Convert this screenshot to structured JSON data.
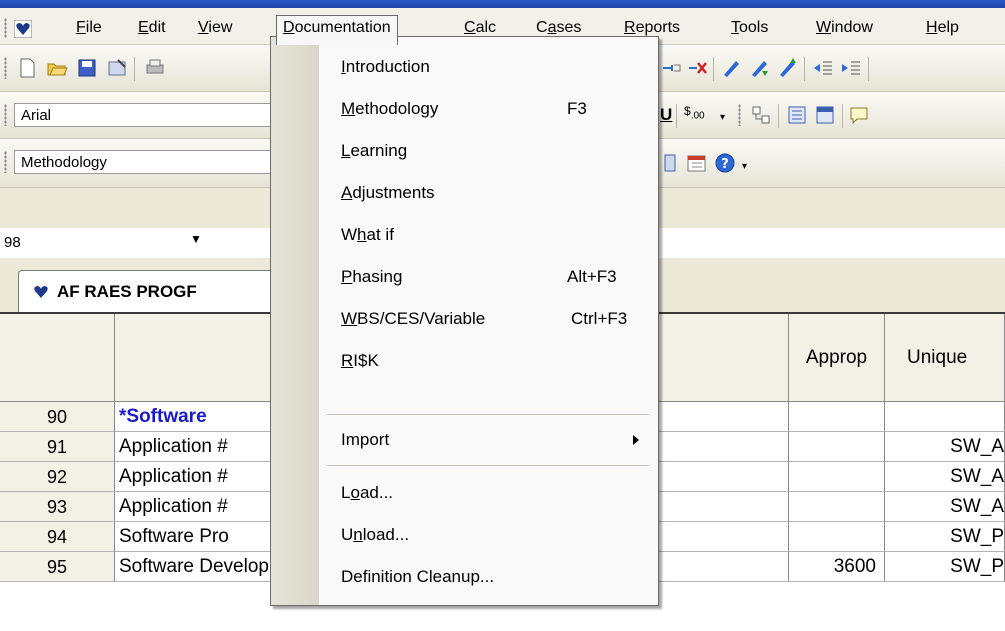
{
  "menubar": {
    "items": [
      "File",
      "Edit",
      "View",
      "Documentation",
      "Calc",
      "Cases",
      "Reports",
      "Tools",
      "Window",
      "Help"
    ]
  },
  "font_box": {
    "value": "Arial"
  },
  "style_box": {
    "value": "Methodology"
  },
  "cell_ref": {
    "value": "98"
  },
  "sheet_tab": {
    "label": "AF RAES PROGF"
  },
  "documentation_menu": {
    "items": [
      {
        "label": "Introduction",
        "shortcut": ""
      },
      {
        "label": "Methodology",
        "shortcut": "F3"
      },
      {
        "label": "Learning",
        "shortcut": ""
      },
      {
        "label": "Adjustments",
        "shortcut": ""
      },
      {
        "label": "What if",
        "shortcut": ""
      },
      {
        "label": "Phasing",
        "shortcut": "Alt+F3"
      },
      {
        "label": "WBS/CES/Variable",
        "shortcut": "Ctrl+F3"
      },
      {
        "label": "RI$K",
        "shortcut": ""
      },
      {
        "label": "Import",
        "shortcut": ""
      },
      {
        "label": "Load...",
        "shortcut": ""
      },
      {
        "label": "Unload...",
        "shortcut": ""
      },
      {
        "label": "Definition Cleanup...",
        "shortcut": ""
      }
    ]
  },
  "grid": {
    "col_headers": {
      "approp": "Approp",
      "unique": "Unique"
    },
    "rows": [
      {
        "num": "90",
        "desc": "*Software",
        "approp": "",
        "unique": ""
      },
      {
        "num": "91",
        "desc": "Application #",
        "approp": "",
        "unique": "SW_A"
      },
      {
        "num": "92",
        "desc": "Application #",
        "approp": "",
        "unique": "SW_A"
      },
      {
        "num": "93",
        "desc": "Application #",
        "approp": "",
        "unique": "SW_A"
      },
      {
        "num": "94",
        "desc": "Software Pro",
        "approp": "",
        "unique": "SW_P"
      },
      {
        "num": "95",
        "desc": "Software Development Rate ($/MM)",
        "approp": "3600",
        "unique": "SW_P"
      }
    ]
  },
  "colors": {
    "accent_heading": "#1a1acc",
    "menu_border": "#6b6b6b"
  }
}
